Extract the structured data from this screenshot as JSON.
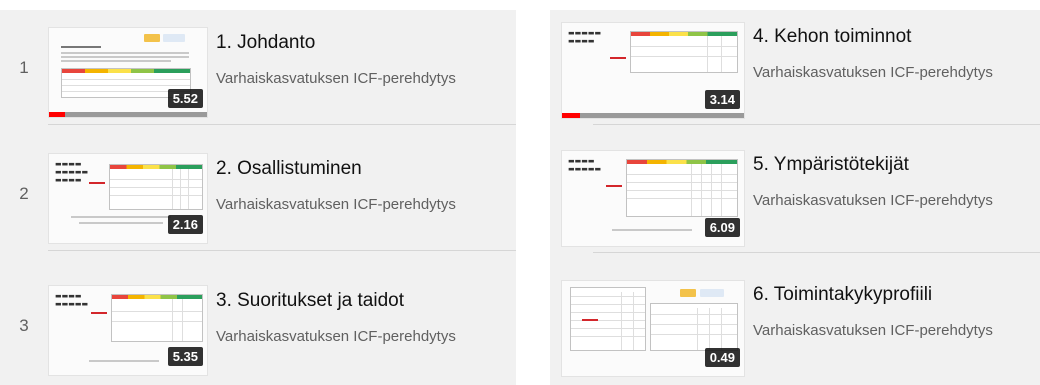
{
  "columns": [
    {
      "items": [
        {
          "index": "1",
          "title": "1. Johdanto",
          "channel": "Varhaiskasvatuksen ICF-perehdytys",
          "duration": "5.52",
          "progress": 0.1
        },
        {
          "index": "2",
          "title": "2. Osallistuminen",
          "channel": "Varhaiskasvatuksen ICF-perehdytys",
          "duration": "2.16",
          "progress": 0
        },
        {
          "index": "3",
          "title": "3. Suoritukset ja taidot",
          "channel": "Varhaiskasvatuksen ICF-perehdytys",
          "duration": "5.35",
          "progress": 0
        }
      ]
    },
    {
      "items": [
        {
          "index": "4",
          "title": "4. Kehon toiminnot",
          "channel": "Varhaiskasvatuksen ICF-perehdytys",
          "duration": "3.14",
          "progress": 0.1
        },
        {
          "index": "5",
          "title": "5. Ympäristötekijät",
          "channel": "Varhaiskasvatuksen ICF-perehdytys",
          "duration": "6.09",
          "progress": 0
        },
        {
          "index": "6",
          "title": "6. Toimintakykyprofiili",
          "channel": "Varhaiskasvatuksen ICF-perehdytys",
          "duration": "0.49",
          "progress": 0
        }
      ]
    }
  ],
  "colors": {
    "progress": "#ff0000",
    "track": "#9a9a9a",
    "panel": "#f1f1f1"
  }
}
